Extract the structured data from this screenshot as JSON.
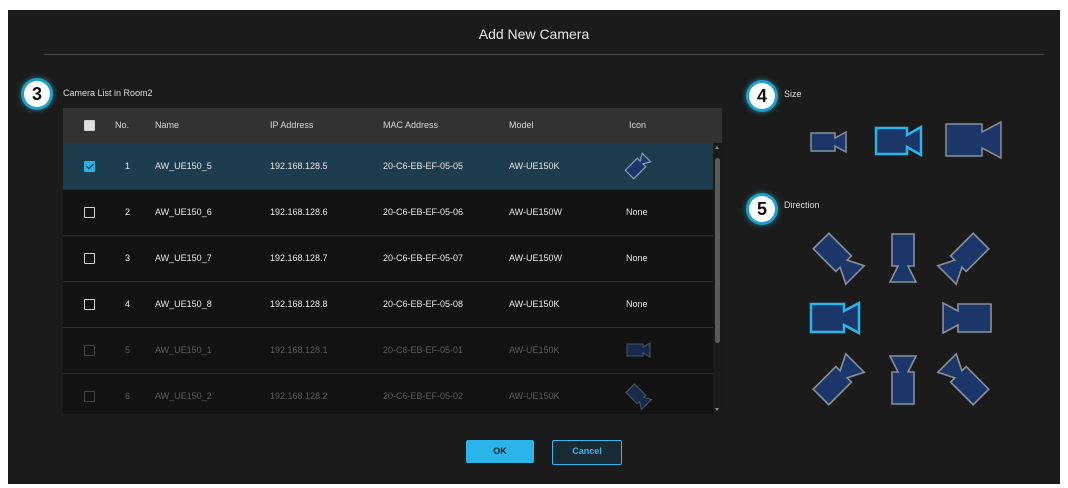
{
  "dialog": {
    "title": "Add New Camera"
  },
  "steps": {
    "list": "3",
    "size": "4",
    "direction": "5"
  },
  "camera_list": {
    "label": "Camera List in Room2",
    "columns": {
      "no": "No.",
      "name": "Name",
      "ip": "IP Address",
      "mac": "MAC Address",
      "model": "Model",
      "icon": "Icon"
    },
    "rows": [
      {
        "no": "1",
        "name": "AW_UE150_5",
        "ip": "192.168.128.5",
        "mac": "20-C6-EB-EF-05-05",
        "model": "AW-UE150K",
        "icon": "",
        "checked": true,
        "enabled": true
      },
      {
        "no": "2",
        "name": "AW_UE150_6",
        "ip": "192.168.128.6",
        "mac": "20-C6-EB-EF-05-06",
        "model": "AW-UE150W",
        "icon": "None",
        "checked": false,
        "enabled": true
      },
      {
        "no": "3",
        "name": "AW_UE150_7",
        "ip": "192.168.128.7",
        "mac": "20-C6-EB-EF-05-07",
        "model": "AW-UE150W",
        "icon": "None",
        "checked": false,
        "enabled": true
      },
      {
        "no": "4",
        "name": "AW_UE150_8",
        "ip": "192.168.128.8",
        "mac": "20-C6-EB-EF-05-08",
        "model": "AW-UE150K",
        "icon": "None",
        "checked": false,
        "enabled": true
      },
      {
        "no": "5",
        "name": "AW_UE150_1",
        "ip": "192.168.128.1",
        "mac": "20-C6-EB-EF-05-01",
        "model": "AW-UE150K",
        "icon": "",
        "checked": false,
        "enabled": false
      },
      {
        "no": "6",
        "name": "AW_UE150_2",
        "ip": "192.168.128.2",
        "mac": "20-C6-EB-EF-05-02",
        "model": "AW-UE150K",
        "icon": "",
        "checked": false,
        "enabled": false
      }
    ]
  },
  "size": {
    "label": "Size",
    "options": [
      "small",
      "medium",
      "large"
    ],
    "selected": "medium"
  },
  "direction": {
    "label": "Direction",
    "options": [
      "up-left",
      "up",
      "up-right",
      "left",
      "right",
      "down-left",
      "down",
      "down-right"
    ],
    "selected": "left"
  },
  "buttons": {
    "ok": "OK",
    "cancel": "Cancel"
  },
  "colors": {
    "accent": "#2ab4ea",
    "camera_fill": "#1b3668",
    "selected_row": "#1d3c4e",
    "dialog_bg": "#1b1b1b"
  },
  "icons": {
    "camera": "camera-icon"
  }
}
